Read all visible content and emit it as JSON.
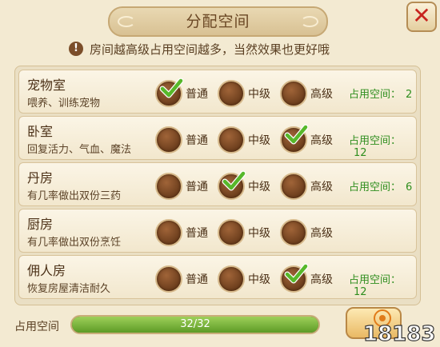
{
  "title": "分配空间",
  "notice": "房间越高级占用空间越多，当然效果也更好哦",
  "options": [
    "普通",
    "中级",
    "高级"
  ],
  "space_label": "占用空间：",
  "rooms": [
    {
      "name": "宠物室",
      "desc": "喂养、训练宠物",
      "selected": "普通",
      "space": "2"
    },
    {
      "name": "卧室",
      "desc": "回复活力、气血、魔法",
      "selected": "高级",
      "space": "12"
    },
    {
      "name": "丹房",
      "desc": "有几率做出双份三药",
      "selected": "中级",
      "space": "6"
    },
    {
      "name": "厨房",
      "desc": "有几率做出双份烹饪",
      "selected": null,
      "space": ""
    },
    {
      "name": "佣人房",
      "desc": "恢复房屋清洁耐久",
      "selected": "高级",
      "space": "12"
    }
  ],
  "footer": {
    "label": "占用空间",
    "used": 32,
    "total": 32,
    "text": "32/32"
  },
  "watermark": "18183",
  "colors": {
    "panel": "#f3ead2",
    "option_brown": "#6b3d1c",
    "check_green": "#57b82a",
    "space_green": "#2f8e1e",
    "close_red": "#c7231e",
    "bar_fill": "#7cb83a"
  },
  "icons": {
    "close": "close-icon",
    "notice": "warning-icon",
    "check": "check-icon"
  }
}
